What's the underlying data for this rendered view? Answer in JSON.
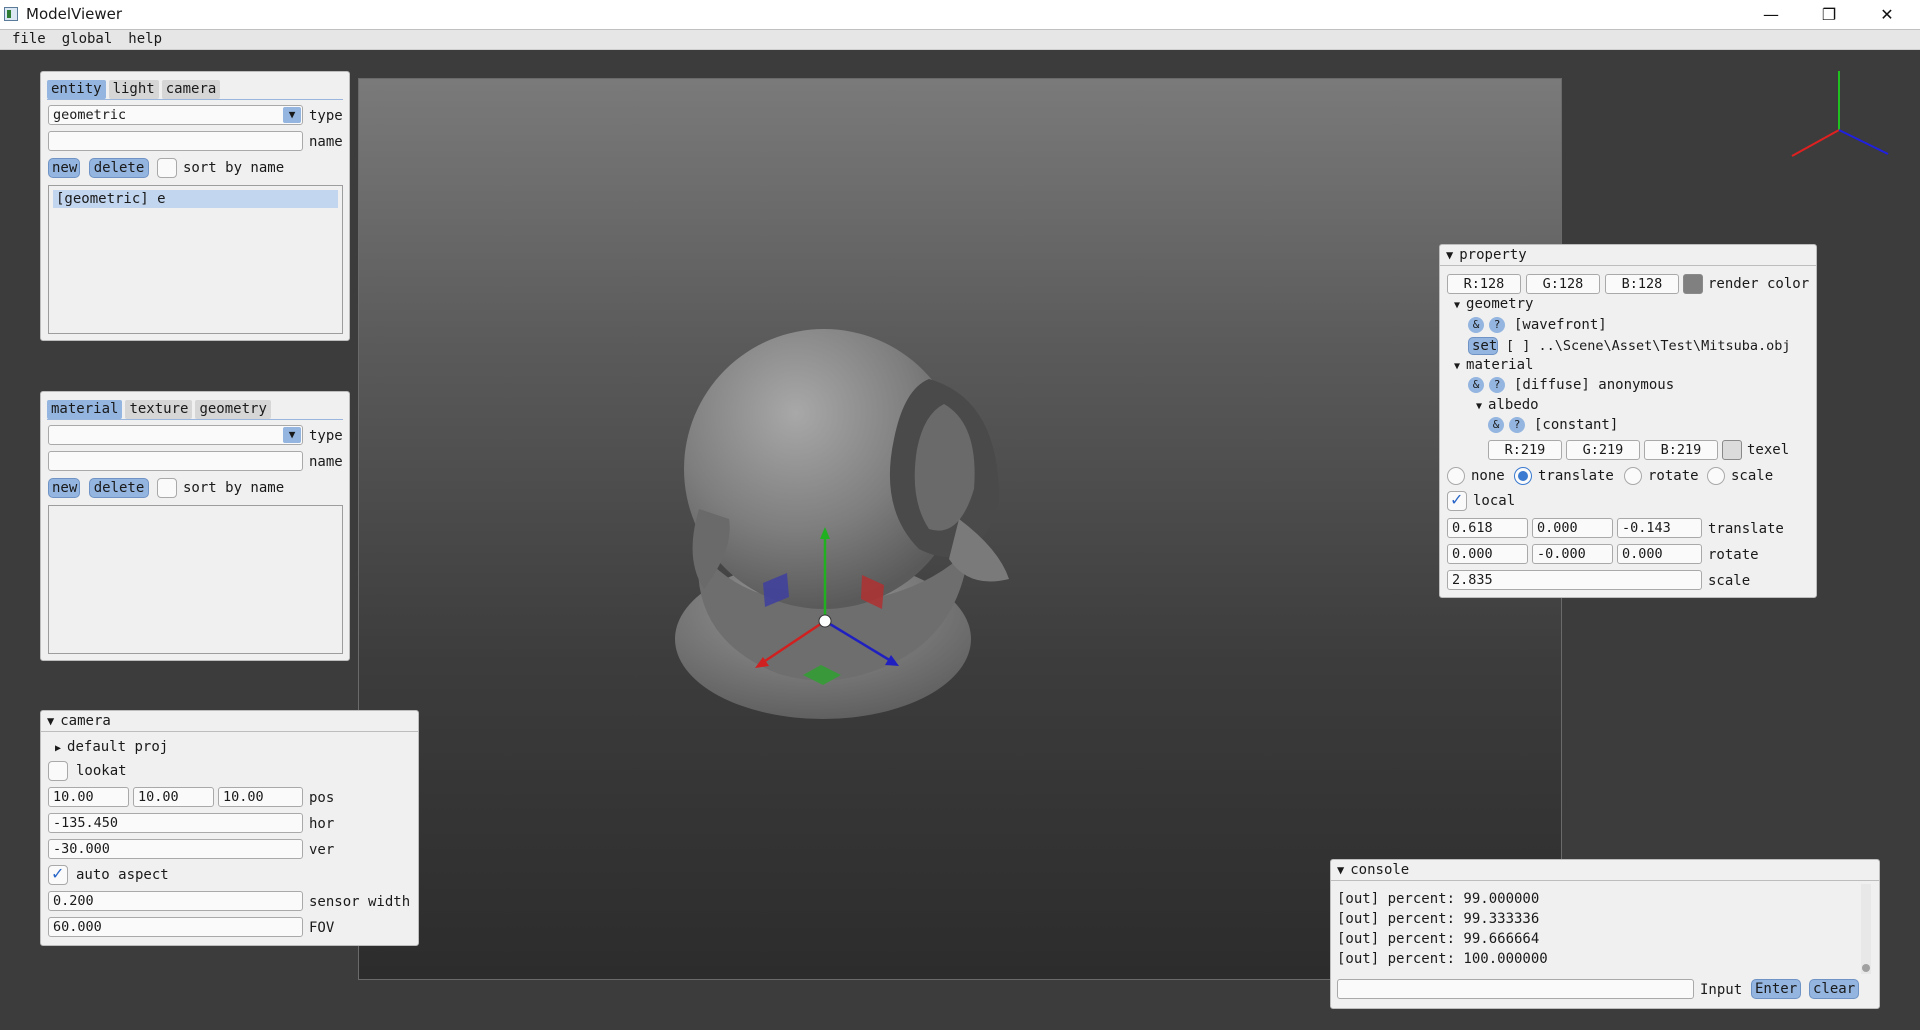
{
  "window": {
    "title": "ModelViewer",
    "controls": [
      "minimize-icon",
      "restore-icon",
      "close-icon"
    ]
  },
  "menu": [
    "file",
    "global",
    "help"
  ],
  "entity_panel": {
    "tabs": [
      "entity",
      "light",
      "camera"
    ],
    "active_tab": "entity",
    "type_value": "geometric",
    "type_label": "type",
    "name_value": "",
    "name_label": "name",
    "new_label": "new",
    "delete_label": "delete",
    "sort_label": "sort by name",
    "items": [
      "[geometric] e"
    ]
  },
  "material_panel": {
    "tabs": [
      "material",
      "texture",
      "geometry"
    ],
    "active_tab": "material",
    "type_value": "",
    "type_label": "type",
    "name_value": "",
    "name_label": "name",
    "new_label": "new",
    "delete_label": "delete",
    "sort_label": "sort by name"
  },
  "camera_panel": {
    "header": "camera",
    "default_proj": "default proj",
    "lookat_label": "lookat",
    "pos": [
      "10.00",
      "10.00",
      "10.00"
    ],
    "pos_label": "pos",
    "hor_value": "-135.450",
    "hor_label": "hor",
    "ver_value": "-30.000",
    "ver_label": "ver",
    "auto_aspect_label": "auto aspect",
    "auto_aspect_checked": true,
    "sensor_width_value": "0.200",
    "sensor_width_label": "sensor width",
    "fov_value": "60.000",
    "fov_label": "FOV"
  },
  "property_panel": {
    "header": "property",
    "render_r": "R:128",
    "render_g": "G:128",
    "render_b": "B:128",
    "render_color_label": "render color",
    "render_swatch": "#808080",
    "geometry_label": "geometry",
    "amp": "&",
    "q": "?",
    "geometry_type": "[wavefront]",
    "set_label": "set",
    "geometry_path": "[ ] ..\\Scene\\Asset\\Test\\Mitsuba.obj",
    "material_label": "material",
    "material_type": "[diffuse] anonymous",
    "albedo_label": "albedo",
    "albedo_type": "[constant]",
    "albedo_r": "R:219",
    "albedo_g": "G:219",
    "albedo_b": "B:219",
    "texel_label": "texel",
    "albedo_swatch": "#dbdbdb",
    "mode_none": "none",
    "mode_translate": "translate",
    "mode_rotate": "rotate",
    "mode_scale": "scale",
    "active_mode": "translate",
    "local_label": "local",
    "local_checked": true,
    "translate": [
      "0.618",
      "0.000",
      "-0.143"
    ],
    "translate_label": "translate",
    "rotate": [
      "0.000",
      "-0.000",
      "0.000"
    ],
    "rotate_label": "rotate",
    "scale_value": "2.835",
    "scale_label": "scale"
  },
  "console": {
    "header": "console",
    "lines": [
      "[out] percent: 99.000000",
      "[out] percent: 99.333336",
      "[out] percent: 99.666664",
      "[out] percent: 100.000000"
    ],
    "input_value": "",
    "input_label": "Input",
    "enter_label": "Enter",
    "clear_label": "clear"
  },
  "colors": {
    "accent": "#93b5e0",
    "axis_x": "#d02020",
    "axis_y": "#20b020",
    "axis_z": "#2020d0"
  }
}
